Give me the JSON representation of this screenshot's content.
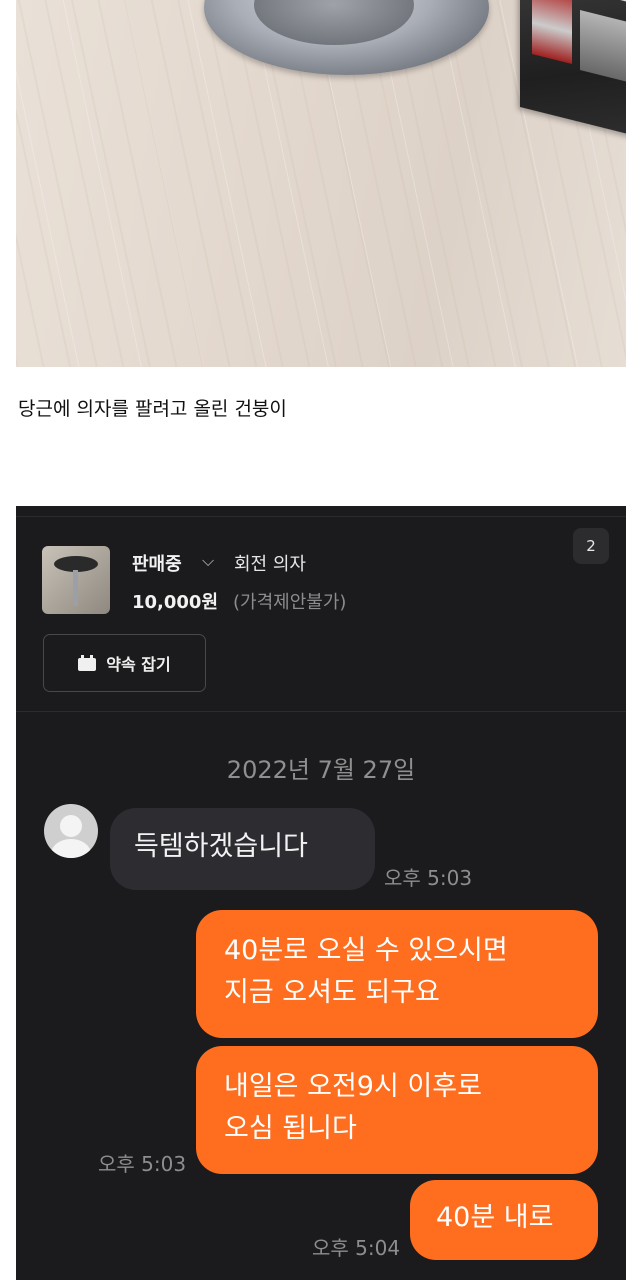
{
  "caption": "당근에 의자를 팔려고 올린 건붕이",
  "chat": {
    "badge": "2",
    "status": "판매중",
    "chevron": "⌵",
    "item_title": "회전 의자",
    "price": "10,000원",
    "price_note": "(가격제안불가)",
    "promise_button": "약속 잡기",
    "date": "2022년 7월 27일",
    "messages": [
      {
        "side": "in",
        "lines": [
          "득템하겠습니다"
        ],
        "time": "오후 5:03"
      },
      {
        "side": "out",
        "lines": [
          "40분로 오실 수 있으시면",
          "지금 오셔도 되구요"
        ]
      },
      {
        "side": "out",
        "lines": [
          "내일은 오전9시 이후로",
          "오심 됩니다"
        ],
        "time": "오후 5:03"
      },
      {
        "side": "out",
        "lines": [
          "40분 내로"
        ],
        "time": "오후 5:04"
      }
    ]
  },
  "colors": {
    "chat_bg": "#1b1b1d",
    "outgoing_bubble": "#ff6d1f",
    "incoming_bubble": "#2d2d31"
  }
}
